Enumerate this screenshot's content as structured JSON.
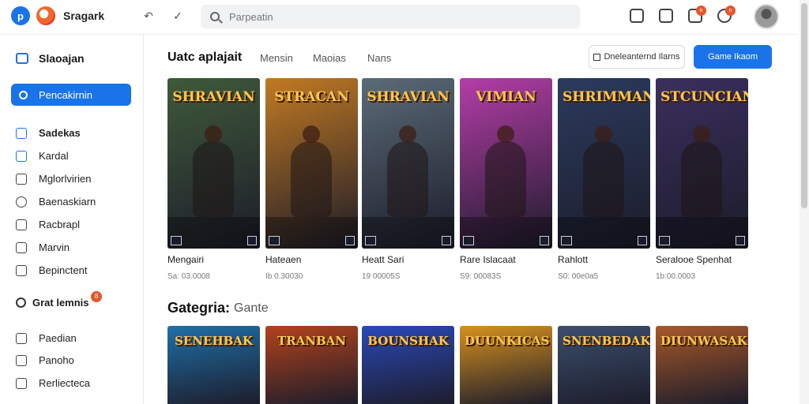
{
  "topbar": {
    "logo_letter": "p",
    "app_name": "Sragark",
    "search_placeholder": "Parpeatin",
    "notif_badge_1": "n",
    "notif_badge_2": "n",
    "icons": [
      "back-icon",
      "check-icon",
      "share-icon",
      "download-icon",
      "notification-icon",
      "notification-icon"
    ]
  },
  "sidebar": {
    "header": "Slaoajan",
    "active_item": "Pencakirnin",
    "items": [
      {
        "label": "Sadekas",
        "icon": "grid-icon"
      },
      {
        "label": "Kardal",
        "icon": "check-square-icon"
      },
      {
        "label": "Mglorlvirien",
        "icon": "square-icon"
      },
      {
        "label": "Baenaskiarn",
        "icon": "circle-icon"
      },
      {
        "label": "Racbrapl",
        "icon": "puzzle-icon"
      },
      {
        "label": "Marvin",
        "icon": "edit-icon"
      },
      {
        "label": "Bepinctent",
        "icon": "list-icon"
      }
    ],
    "section_label": "Grat lemnis",
    "section_badge": "8",
    "section_items": [
      {
        "label": "Paedian",
        "icon": "square-icon"
      },
      {
        "label": "Panoho",
        "icon": "edit-icon"
      },
      {
        "label": "Rerliecteca",
        "icon": "square-icon"
      }
    ]
  },
  "main": {
    "title": "Uatc aplajait",
    "tabs": [
      "Mensin",
      "Maoias",
      "Nans"
    ],
    "btn_outline": "Dneleanternd Ilarns",
    "btn_primary": "Game Ikaom",
    "cards": [
      {
        "art": "SHRAVIAN",
        "name": "Mengairi",
        "meta": "Sa: 03.0008",
        "bg": "#3f5a3a"
      },
      {
        "art": "STRACAN",
        "name": "Hateaen",
        "meta": "Ib 0.30030",
        "bg": "#c27a22"
      },
      {
        "art": "SHRAVIAN",
        "name": "Heatt Sari",
        "meta": "19 00005S",
        "bg": "#5b6b78"
      },
      {
        "art": "VIMIAN",
        "name": "Rare Islacaat",
        "meta": "S9: 00083S",
        "bg": "#b43da8"
      },
      {
        "art": "SHRIMMAN",
        "name": "Rahlott",
        "meta": "S0: 00e0a5",
        "bg": "#2b3b5e"
      },
      {
        "art": "STCUNCIAN",
        "name": "Seralooe Spenhat",
        "meta": "1b:00.0003",
        "bg": "#3a2f5e"
      }
    ],
    "category_title": "Gategria:",
    "category_sub": "Gante",
    "cards2": [
      {
        "art": "SENEHBAK",
        "bg": "#1f6fa8"
      },
      {
        "art": "TRANBAN",
        "bg": "#b3421d"
      },
      {
        "art": "BOUNSHAK",
        "bg": "#2a48b8"
      },
      {
        "art": "DUUNKICAS",
        "bg": "#d7911f"
      },
      {
        "art": "SNENBEDAK",
        "bg": "#3b4f6e"
      },
      {
        "art": "DIUNWASAK",
        "bg": "#a8582a"
      }
    ]
  }
}
